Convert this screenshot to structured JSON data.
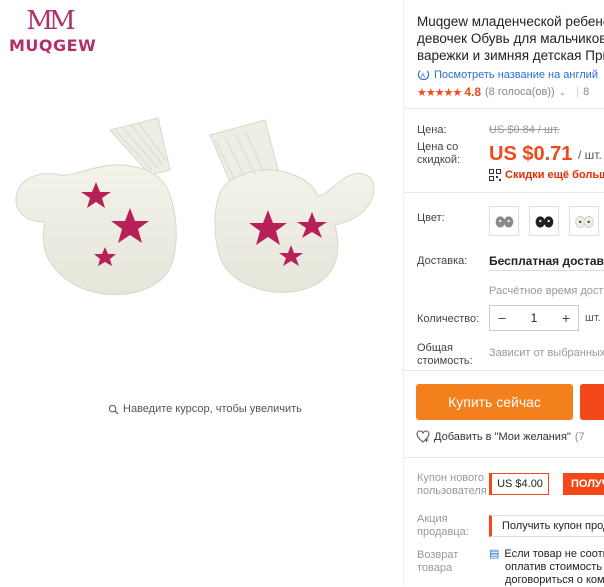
{
  "brand": {
    "mark": "MM",
    "name": "MUQGEW"
  },
  "gallery": {
    "zoom_hint": "Наведите курсор, чтобы увеличить"
  },
  "product": {
    "title_line1": "Muqgew младенческой ребенок",
    "title_line2": "девочек Обувь для мальчиков",
    "title_line3": "варежки и зимняя детская При",
    "translate_link": "Посмотреть название на англий",
    "rating": "4.8",
    "stars": "★★★★★",
    "votes": "(8 голоса(ов))",
    "extra": "8"
  },
  "price": {
    "label": "Цена:",
    "original": "US $0.84 / шт.",
    "discount_label_1": "Цена со",
    "discount_label_2": "скидкой:",
    "current": "US $0.71",
    "unit": "/ шт.",
    "promo": "Скидки ещё больше"
  },
  "color": {
    "label": "Цвет:"
  },
  "shipping": {
    "label": "Доставка:",
    "method": "Бесплатная доставка",
    "estimate": "Расчётное время доставки"
  },
  "quantity": {
    "label": "Количество:",
    "value": "1",
    "minus": "−",
    "plus": "+",
    "unit": "шт."
  },
  "total": {
    "label_1": "Общая",
    "label_2": "стоимость:",
    "value": "Зависит от выбранных"
  },
  "actions": {
    "buy_now": "Купить сейчас",
    "wishlist": "Добавить в \"Мои желания\"",
    "wishlist_count": "(7"
  },
  "coupon": {
    "label_1": "Купон нового",
    "label_2": "пользователя",
    "amount": "US $4.00",
    "get": "ПОЛУЧ"
  },
  "seller_promo": {
    "label_1": "Акция",
    "label_2": "продавца:",
    "text": "Получить купон прод"
  },
  "returns": {
    "label_1": "Возврат",
    "label_2": "товара",
    "line1": "Если товар не соотв",
    "line2": "оплатив стоимость",
    "line3": "договориться о ком"
  },
  "colors": {
    "accent": "#f34819",
    "buy": "#f3801c",
    "link": "#2b6fcf"
  }
}
